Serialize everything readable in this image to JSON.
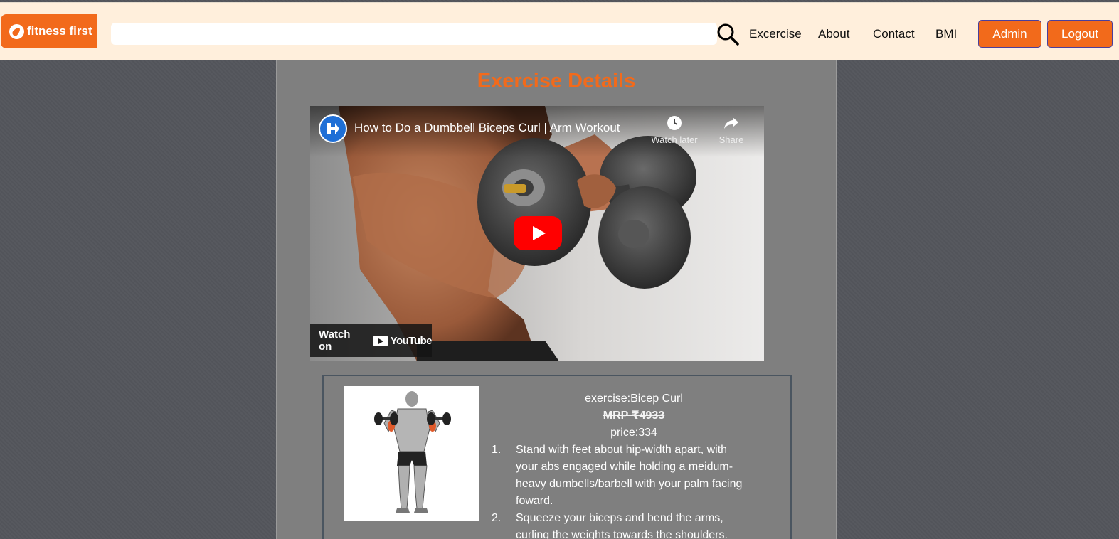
{
  "brand": {
    "name": "fitness first",
    "accent": "#f26a1b"
  },
  "search": {
    "placeholder": "",
    "value": ""
  },
  "nav": {
    "links": [
      "Excercise",
      "About",
      "Contact",
      "BMI"
    ],
    "admin_label": "Admin",
    "logout_label": "Logout"
  },
  "page": {
    "title": "Exercise Details"
  },
  "video": {
    "title": "How to Do a Dumbbell Biceps Curl | Arm Workout",
    "watch_later": "Watch later",
    "share": "Share",
    "watch_on": "Watch on",
    "platform": "YouTube"
  },
  "exercise": {
    "name_line": "exercise:Bicep Curl",
    "mrp": "MRP ₹4933",
    "price_line": "price:334",
    "steps": [
      {
        "num": "1.",
        "text": "Stand with feet about hip-width apart, with your abs engaged while holding a meidum-heavy dumbells/barbell with your palm facing foward."
      },
      {
        "num": "2.",
        "text": "Squeeze your biceps and bend the arms, curling the weights towards the shoulders."
      }
    ]
  }
}
